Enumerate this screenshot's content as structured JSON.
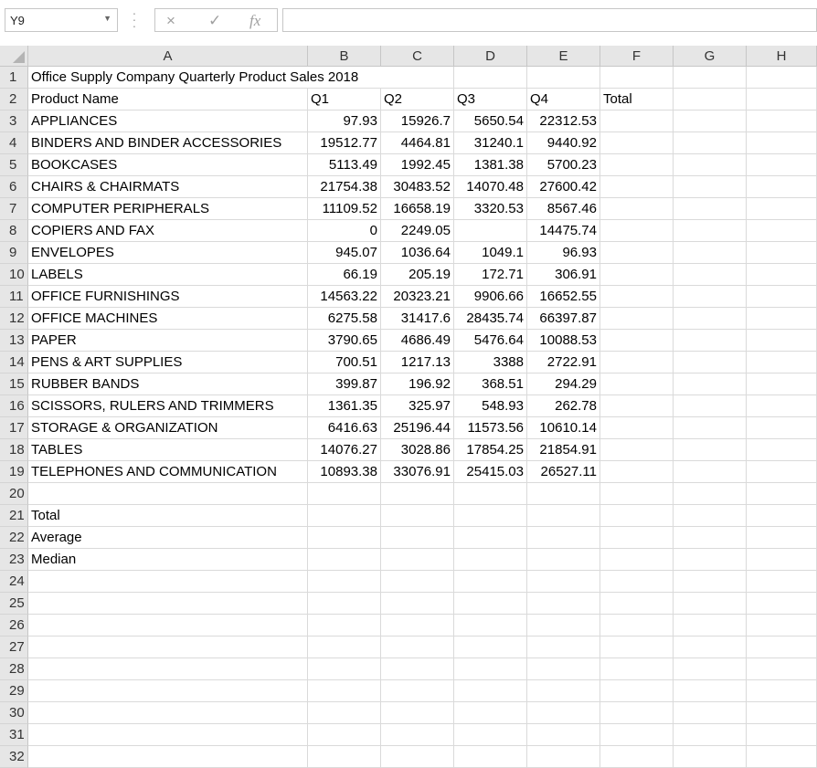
{
  "namebox": {
    "value": "Y9",
    "dropdown_icon": "chevron-down-icon"
  },
  "formula_bar": {
    "cancel_icon": "×",
    "enter_icon": "✓",
    "fx_label": "fx",
    "content": ""
  },
  "columns": [
    "A",
    "B",
    "C",
    "D",
    "E",
    "F",
    "G",
    "H"
  ],
  "row_count": 32,
  "title": "Office Supply Company Quarterly Product Sales 2018",
  "header": [
    "Product Name",
    "Q1",
    "Q2",
    "Q3",
    "Q4",
    "Total"
  ],
  "rows": [
    [
      "APPLIANCES",
      "97.93",
      "15926.7",
      "5650.54",
      "22312.53"
    ],
    [
      "BINDERS AND BINDER ACCESSORIES",
      "19512.77",
      "4464.81",
      "31240.1",
      "9440.92"
    ],
    [
      "BOOKCASES",
      "5113.49",
      "1992.45",
      "1381.38",
      "5700.23"
    ],
    [
      "CHAIRS & CHAIRMATS",
      "21754.38",
      "30483.52",
      "14070.48",
      "27600.42"
    ],
    [
      "COMPUTER PERIPHERALS",
      "11109.52",
      "16658.19",
      "3320.53",
      "8567.46"
    ],
    [
      "COPIERS AND FAX",
      "0",
      "2249.05",
      "",
      "14475.74"
    ],
    [
      "ENVELOPES",
      "945.07",
      "1036.64",
      "1049.1",
      "96.93"
    ],
    [
      "LABELS",
      "66.19",
      "205.19",
      "172.71",
      "306.91"
    ],
    [
      "OFFICE FURNISHINGS",
      "14563.22",
      "20323.21",
      "9906.66",
      "16652.55"
    ],
    [
      "OFFICE MACHINES",
      "6275.58",
      "31417.6",
      "28435.74",
      "66397.87"
    ],
    [
      "PAPER",
      "3790.65",
      "4686.49",
      "5476.64",
      "10088.53"
    ],
    [
      "PENS & ART SUPPLIES",
      "700.51",
      "1217.13",
      "3388",
      "2722.91"
    ],
    [
      "RUBBER BANDS",
      "399.87",
      "196.92",
      "368.51",
      "294.29"
    ],
    [
      "SCISSORS, RULERS AND TRIMMERS",
      "1361.35",
      "325.97",
      "548.93",
      "262.78"
    ],
    [
      "STORAGE & ORGANIZATION",
      "6416.63",
      "25196.44",
      "11573.56",
      "10610.14"
    ],
    [
      "TABLES",
      "14076.27",
      "3028.86",
      "17854.25",
      "21854.91"
    ],
    [
      "TELEPHONES AND COMMUNICATION",
      "10893.38",
      "33076.91",
      "25415.03",
      "26527.11"
    ]
  ],
  "summary_labels": [
    "Total",
    "Average",
    "Median"
  ]
}
